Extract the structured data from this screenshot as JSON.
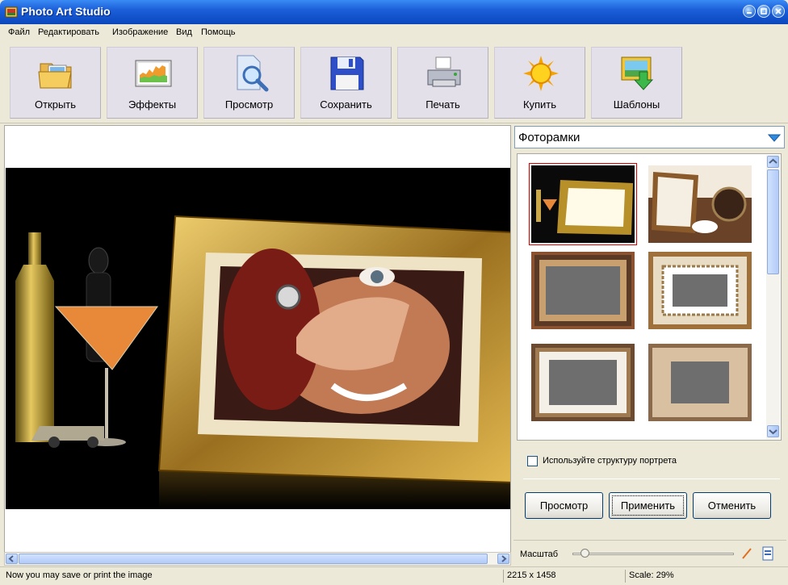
{
  "window": {
    "title": "Photo Art Studio"
  },
  "menu": [
    "Файл",
    "Редактировать",
    "Изображение",
    "Вид",
    "Помощь"
  ],
  "toolbar": [
    {
      "label": "Открыть",
      "icon": "open-folder-icon"
    },
    {
      "label": "Эффекты",
      "icon": "effects-icon"
    },
    {
      "label": "Просмотр",
      "icon": "preview-magnifier-icon"
    },
    {
      "label": "Сохранить",
      "icon": "save-floppy-icon"
    },
    {
      "label": "Печать",
      "icon": "printer-icon"
    },
    {
      "label": "Купить",
      "icon": "buy-sun-icon"
    },
    {
      "label": "Шаблоны",
      "icon": "templates-icon"
    }
  ],
  "panel": {
    "category": "Фоторамки",
    "checkbox_label": "Используйте структуру портрета",
    "checkbox_checked": false,
    "buttons": {
      "preview": "Просмотр",
      "apply": "Применить",
      "cancel": "Отменить"
    },
    "zoom_label": "Масштаб",
    "zoom_level": 0.05
  },
  "thumbnails": [
    {
      "name": "frame-cocktail",
      "selected": true
    },
    {
      "name": "frame-coffee",
      "selected": false
    },
    {
      "name": "frame-dark-wood",
      "selected": false
    },
    {
      "name": "frame-patterned",
      "selected": false
    },
    {
      "name": "frame-white-mat",
      "selected": false
    },
    {
      "name": "frame-marble",
      "selected": false
    }
  ],
  "status": {
    "message": "Now you may save or print the image",
    "dimensions": "2215 x 1458",
    "scale": "Scale: 29%"
  },
  "colors": {
    "title_bar": "#1c5fd8",
    "selection": "#e00000",
    "frame_gold": "#c9a040"
  }
}
